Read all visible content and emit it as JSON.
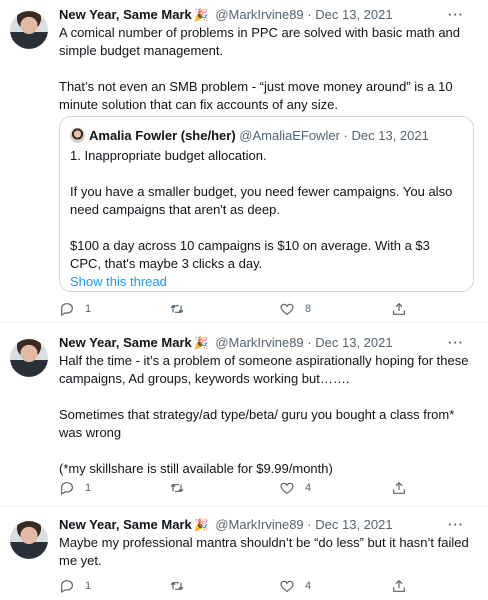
{
  "tweets": [
    {
      "author_name": "New Year, Same Mark",
      "author_emoji": "🎉",
      "handle": "@MarkIrvine89",
      "separator": "·",
      "date": "Dec 13, 2021",
      "more": "···",
      "paragraphs": [
        "A comical number of problems in PPC are solved with basic math and simple budget management.",
        "That’s not even an SMB problem - “just move money around” is a 10 minute solution that can fix accounts of any size."
      ],
      "quote": {
        "author_name": "Amalia Fowler (she/her)",
        "handle": "@AmaliaEFowler",
        "separator": "·",
        "date": "Dec 13, 2021",
        "paragraphs": [
          "1. Inappropriate budget allocation.",
          "If you have a smaller budget, you need fewer campaigns. You also need campaigns that aren't as deep.",
          "$100 a day across 10 campaigns is $10 on average. With a $3 CPC, that's maybe 3 clicks a day."
        ],
        "show_thread": "Show this thread"
      },
      "replies": "1",
      "retweets": "",
      "likes": "8"
    },
    {
      "author_name": "New Year, Same Mark",
      "author_emoji": "🎉",
      "handle": "@MarkIrvine89",
      "separator": "·",
      "date": "Dec 13, 2021",
      "more": "···",
      "paragraphs": [
        "Half the time - it’s a problem of someone aspirationally hoping for these campaigns, Ad groups, keywords working but…….",
        "Sometimes that strategy/ad type/beta/ guru you bought a class from* was wrong",
        "(*my skillshare is still available for $9.99/month)"
      ],
      "replies": "1",
      "retweets": "",
      "likes": "4"
    },
    {
      "author_name": "New Year, Same Mark",
      "author_emoji": "🎉",
      "handle": "@MarkIrvine89",
      "separator": "·",
      "date": "Dec 13, 2021",
      "more": "···",
      "paragraphs": [
        "Maybe my professional mantra shouldn’t be “do less” but it hasn’t failed me yet."
      ],
      "replies": "1",
      "retweets": "",
      "likes": "4"
    }
  ],
  "icons": {
    "reply": "reply-icon",
    "retweet": "retweet-icon",
    "like": "heart-icon",
    "share": "share-icon"
  },
  "colors": {
    "text": "#0f1419",
    "secondary": "#536471",
    "link": "#1d9bf0",
    "border": "#cfd9de"
  }
}
